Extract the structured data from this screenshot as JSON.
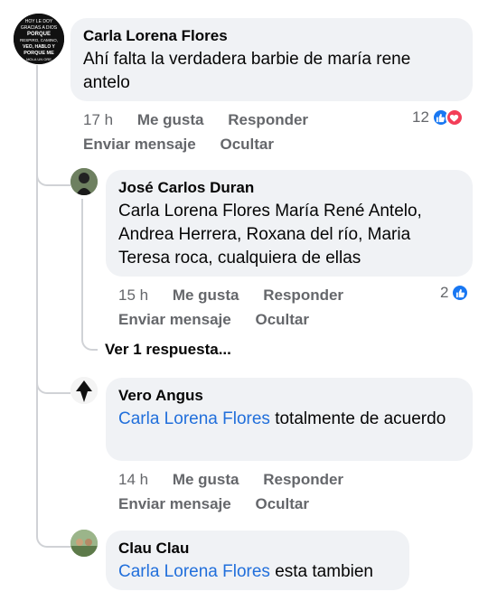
{
  "comments": [
    {
      "author": "Carla Lorena Flores",
      "text": "Ahí falta la verdadera barbie de maría rene antelo",
      "time": "17 h",
      "like": "Me gusta",
      "reply": "Responder",
      "message": "Enviar mensaje",
      "hide": "Ocultar",
      "reactions_count": "12",
      "reactions": [
        "like-icon",
        "love-icon"
      ],
      "avatar_lines": [
        "HOY LE DOY",
        "GRACIAS A DIOS",
        "PORQUE",
        "RESPIRO, CAMINO,",
        "VEO, HABLO Y",
        "PORQUE ME",
        "MOLA UN ORE"
      ]
    },
    {
      "author": "José Carlos Duran",
      "text": "Carla Lorena Flores María René Antelo, Andrea Herrera, Roxana del río, Maria Teresa roca, cualquiera de ellas",
      "time": "15 h",
      "like": "Me gusta",
      "reply": "Responder",
      "message": "Enviar mensaje",
      "hide": "Ocultar",
      "reactions_count": "2",
      "reactions": [
        "like-icon"
      ]
    },
    {
      "author": "Vero Angus",
      "mention": "Carla Lorena Flores",
      "text": " totalmente de acuerdo",
      "time": "14 h",
      "like": "Me gusta",
      "reply": "Responder",
      "message": "Enviar mensaje",
      "hide": "Ocultar"
    },
    {
      "author": "Clau Clau",
      "mention": "Carla Lorena Flores",
      "text": " esta tambien"
    }
  ],
  "more_replies": "Ver 1 respuesta...",
  "colors": {
    "bubble": "#f0f2f5",
    "mention": "#216fdb",
    "secondary": "#65676b",
    "like": "#1877f2",
    "love": "#f33e58"
  }
}
